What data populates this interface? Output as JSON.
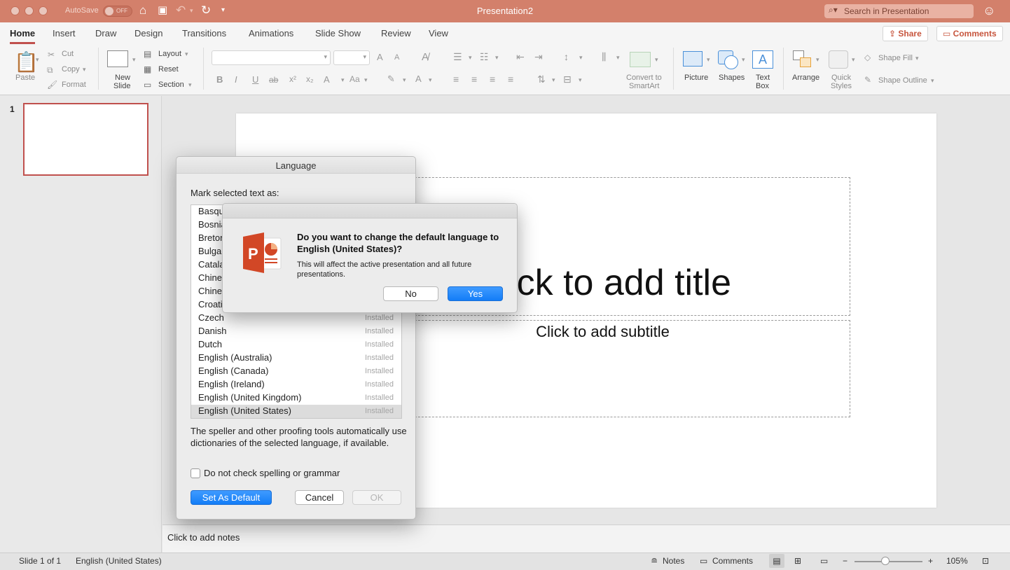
{
  "titlebar": {
    "autosave_label": "AutoSave",
    "autosave_state": "OFF",
    "document_title": "Presentation2",
    "search_placeholder": "Search in Presentation"
  },
  "ribbon": {
    "tabs": [
      "Home",
      "Insert",
      "Draw",
      "Design",
      "Transitions",
      "Animations",
      "Slide Show",
      "Review",
      "View"
    ],
    "active_tab": "Home",
    "share_label": "Share",
    "comments_label": "Comments",
    "clipboard": {
      "paste": "Paste",
      "cut": "Cut",
      "copy": "Copy",
      "format": "Format"
    },
    "slides": {
      "new_slide_line1": "New",
      "new_slide_line2": "Slide",
      "layout": "Layout",
      "reset": "Reset",
      "section": "Section"
    },
    "font": {
      "bold": "B",
      "italic": "I",
      "underline": "U",
      "strike": "ab",
      "superscript": "x²",
      "subscript": "x₂",
      "change_case": "Aa",
      "grow": "A",
      "shrink": "A"
    },
    "convert_smartart_line1": "Convert to",
    "convert_smartart_line2": "SmartArt",
    "insert": {
      "picture": "Picture",
      "shapes": "Shapes",
      "textbox_line1": "Text",
      "textbox_line2": "Box"
    },
    "arrange": {
      "arrange": "Arrange",
      "quick_styles_line1": "Quick",
      "quick_styles_line2": "Styles",
      "shape_fill": "Shape Fill",
      "shape_outline": "Shape Outline"
    }
  },
  "thumbnails": {
    "slide_number": "1"
  },
  "slide": {
    "title_placeholder": "Click to add title",
    "subtitle_placeholder": "Click to add subtitle"
  },
  "notes": {
    "placeholder": "Click to add notes"
  },
  "statusbar": {
    "slide_counter": "Slide 1 of 1",
    "language": "English (United States)",
    "notes_label": "Notes",
    "comments_label": "Comments",
    "zoom": "105%",
    "zoom_level": 0.45
  },
  "language_dialog": {
    "title": "Language",
    "mark_label": "Mark selected text as:",
    "languages": [
      {
        "name": "Basque",
        "status": ""
      },
      {
        "name": "Bosnian",
        "status": ""
      },
      {
        "name": "Breton",
        "status": ""
      },
      {
        "name": "Bulgarian",
        "status": ""
      },
      {
        "name": "Catalan",
        "status": ""
      },
      {
        "name": "Chinese",
        "status": ""
      },
      {
        "name": "Chinese",
        "status": ""
      },
      {
        "name": "Croatian",
        "status": ""
      },
      {
        "name": "Czech",
        "status": "Installed"
      },
      {
        "name": "Danish",
        "status": "Installed"
      },
      {
        "name": "Dutch",
        "status": "Installed"
      },
      {
        "name": "English (Australia)",
        "status": "Installed"
      },
      {
        "name": "English (Canada)",
        "status": "Installed"
      },
      {
        "name": "English (Ireland)",
        "status": "Installed"
      },
      {
        "name": "English (United Kingdom)",
        "status": "Installed"
      },
      {
        "name": "English (United States)",
        "status": "Installed"
      }
    ],
    "selected_language": "English (United States)",
    "proofing_note": "The speller and other proofing tools automatically use dictionaries of the selected language, if available.",
    "no_check_label": "Do not check spelling or grammar",
    "set_default_label": "Set As Default",
    "cancel_label": "Cancel",
    "ok_label": "OK"
  },
  "alert": {
    "question": "Do you want to change the default language to English (United States)?",
    "info": "This will affect the active presentation and all future presentations.",
    "no_label": "No",
    "yes_label": "Yes",
    "icon": "powerpoint-app-icon"
  },
  "colors": {
    "titlebar": "#d3806b",
    "accent": "#c0504d",
    "default_button": "#137df7",
    "powerpoint_orange": "#d24726"
  }
}
